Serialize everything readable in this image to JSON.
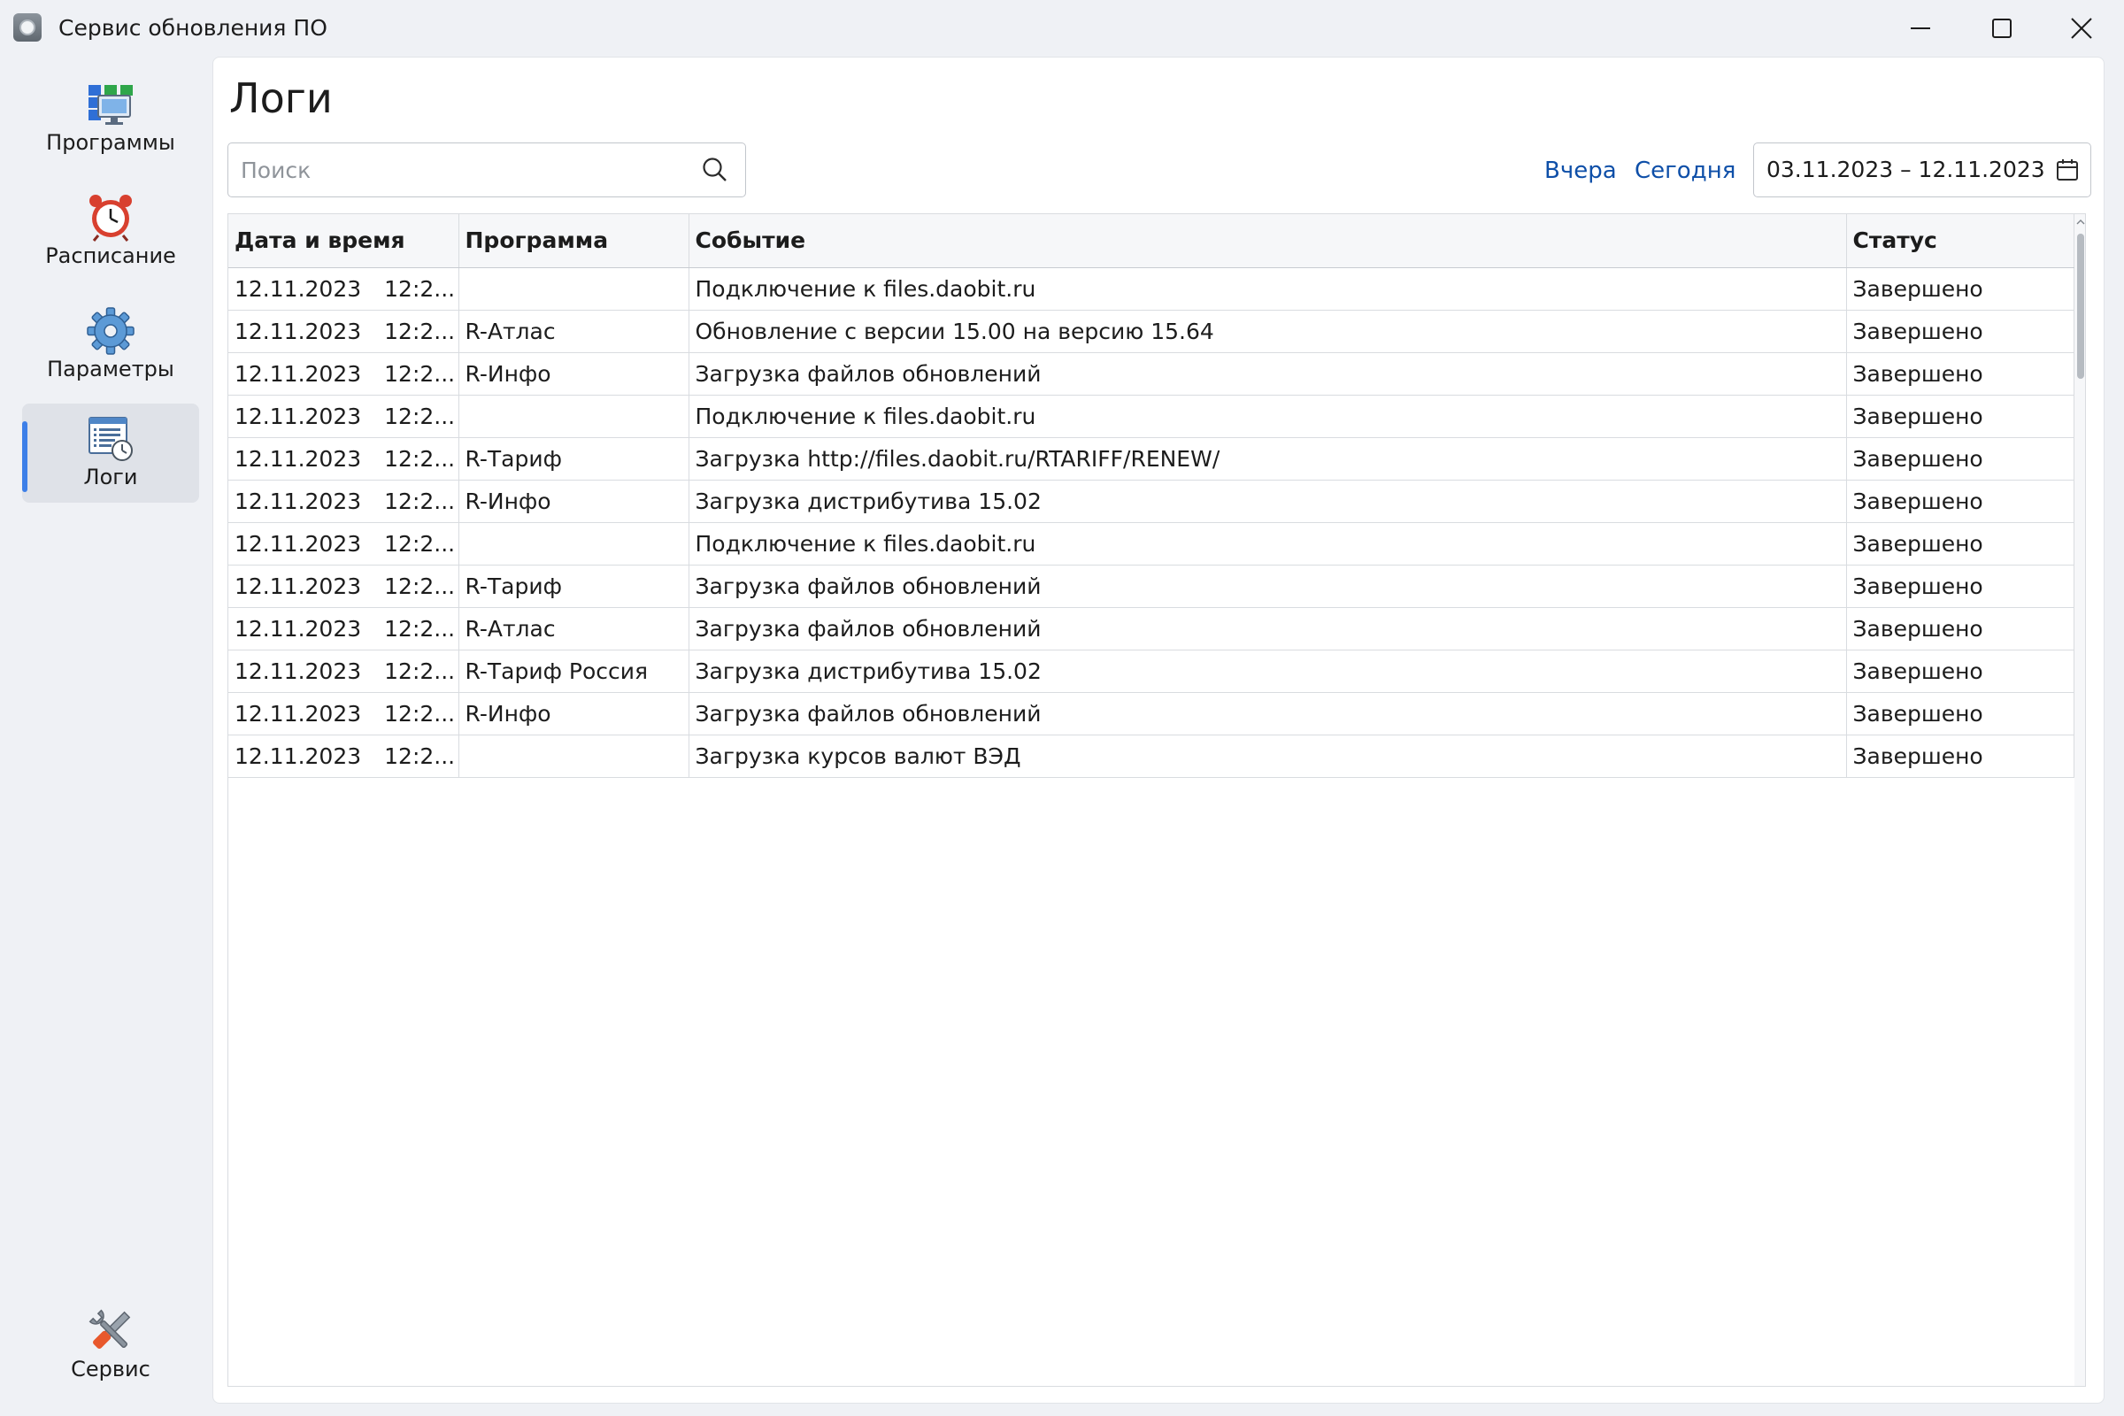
{
  "window": {
    "title": "Сервис обновления ПО"
  },
  "sidebar": {
    "items": [
      {
        "label": "Программы",
        "icon": "programs-icon"
      },
      {
        "label": "Расписание",
        "icon": "alarm-clock-icon"
      },
      {
        "label": "Параметры",
        "icon": "gear-icon"
      },
      {
        "label": "Логи",
        "icon": "logs-icon"
      }
    ],
    "active_index": 3,
    "bottom_item": {
      "label": "Сервис",
      "icon": "tools-icon"
    }
  },
  "main": {
    "title": "Логи",
    "search": {
      "placeholder": "Поиск",
      "value": ""
    },
    "quick_links": {
      "yesterday": "Вчера",
      "today": "Сегодня"
    },
    "date_range": "03.11.2023 – 12.11.2023"
  },
  "table": {
    "columns": [
      "Дата и время",
      "Программа",
      "Событие",
      "Статус"
    ],
    "rows": [
      {
        "date": "12.11.2023",
        "time": "12:2...",
        "program": "",
        "event": "Подключение к files.daobit.ru",
        "status": "Завершено"
      },
      {
        "date": "12.11.2023",
        "time": "12:2...",
        "program": "R-Атлас",
        "event": "Обновление с версии 15.00 на версию 15.64",
        "status": "Завершено"
      },
      {
        "date": "12.11.2023",
        "time": "12:2...",
        "program": "R-Инфо",
        "event": "Загрузка файлов обновлений",
        "status": "Завершено"
      },
      {
        "date": "12.11.2023",
        "time": "12:2...",
        "program": "",
        "event": "Подключение к files.daobit.ru",
        "status": "Завершено"
      },
      {
        "date": "12.11.2023",
        "time": "12:2...",
        "program": "R-Тариф",
        "event": "Загрузка http://files.daobit.ru/RTARIFF/RENEW/",
        "status": "Завершено"
      },
      {
        "date": "12.11.2023",
        "time": "12:2...",
        "program": "R-Инфо",
        "event": "Загрузка дистрибутива 15.02",
        "status": "Завершено"
      },
      {
        "date": "12.11.2023",
        "time": "12:2...",
        "program": "",
        "event": "Подключение к files.daobit.ru",
        "status": "Завершено"
      },
      {
        "date": "12.11.2023",
        "time": "12:2...",
        "program": "R-Тариф",
        "event": "Загрузка файлов обновлений",
        "status": "Завершено"
      },
      {
        "date": "12.11.2023",
        "time": "12:2...",
        "program": "R-Атлас",
        "event": "Загрузка файлов обновлений",
        "status": "Завершено"
      },
      {
        "date": "12.11.2023",
        "time": "12:2...",
        "program": "R-Тариф Россия",
        "event": "Загрузка дистрибутива 15.02",
        "status": "Завершено"
      },
      {
        "date": "12.11.2023",
        "time": "12:2...",
        "program": "R-Инфо",
        "event": "Загрузка файлов обновлений",
        "status": "Завершено"
      },
      {
        "date": "12.11.2023",
        "time": "12:2...",
        "program": "",
        "event": "Загрузка курсов валют ВЭД",
        "status": "Завершено"
      }
    ]
  },
  "colors": {
    "accent": "#3d7fe8",
    "link": "#0e4fa8",
    "background": "#eff1f5"
  }
}
